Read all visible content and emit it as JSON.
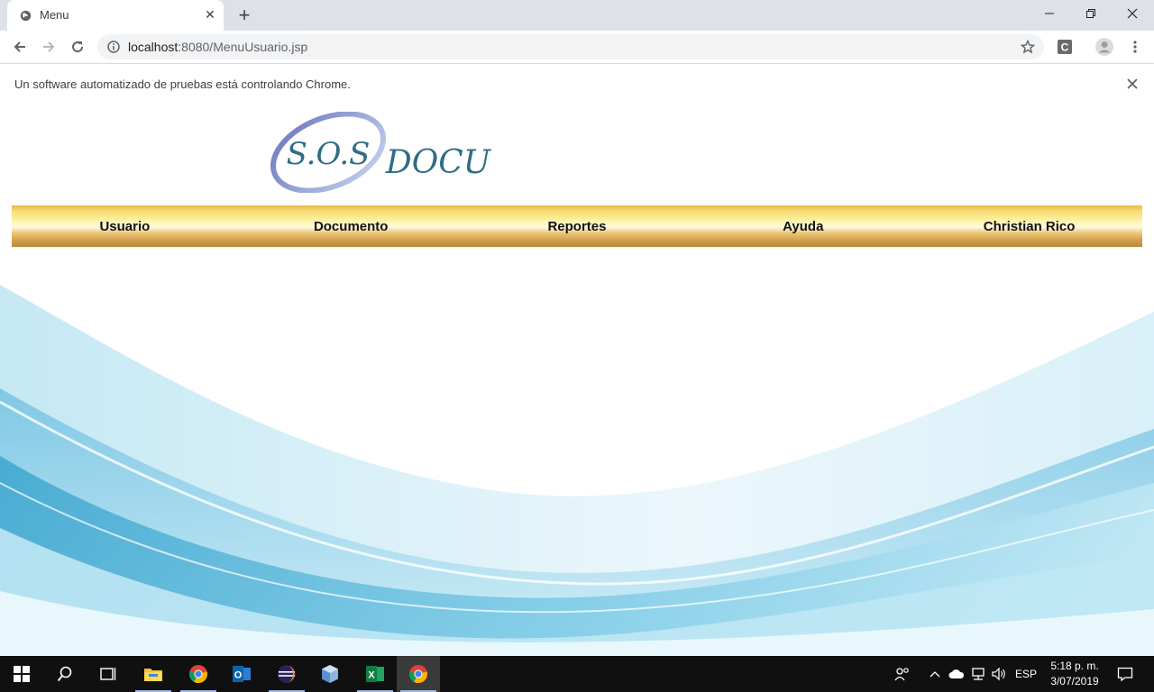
{
  "browser": {
    "tab_title": "Menu",
    "tab_close": "✕",
    "new_tab": "+",
    "url_host": "localhost",
    "url_path": ":8080/MenuUsuario.jsp",
    "info_message": "Un software automatizado de pruebas está controlando Chrome."
  },
  "page": {
    "logo_emblem": "S.O.S",
    "logo_word": "DOCU",
    "menu": [
      {
        "label": "Usuario"
      },
      {
        "label": "Documento"
      },
      {
        "label": "Reportes"
      },
      {
        "label": "Ayuda"
      },
      {
        "label": "Christian Rico"
      }
    ]
  },
  "taskbar": {
    "icons": [
      "windows-start-icon",
      "search-icon",
      "task-view-icon",
      "file-explorer-icon",
      "chrome-icon",
      "outlook-icon",
      "eclipse-icon",
      "virtualbox-icon",
      "excel-icon",
      "chrome-active-icon"
    ],
    "language": "ESP",
    "time": "5:18 p. m.",
    "date": "3/07/2019"
  },
  "colors": {
    "menu_gold": "#e8b94a",
    "logo_teal": "#2f6d86",
    "taskbar": "#101010"
  }
}
